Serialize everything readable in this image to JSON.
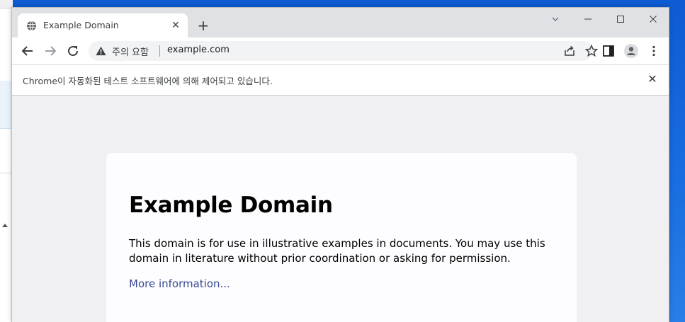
{
  "tab": {
    "title": "Example Domain",
    "close_icon": "close-icon"
  },
  "toolbar": {
    "security_label": "주의 요함",
    "url": "example.com"
  },
  "infobar": {
    "message": "Chrome이 자동화된 테스트 소프트웨어에 의해 제어되고 있습니다."
  },
  "page": {
    "heading": "Example Domain",
    "body": "This domain is for use in illustrative examples in documents. You may use this domain in literature without prior coordination or asking for permission.",
    "link": "More information..."
  },
  "colors": {
    "link": "#38488f",
    "tabstrip": "#dfe1e5",
    "omnibox": "#f1f3f4",
    "page_bg": "#f0f0f2"
  }
}
